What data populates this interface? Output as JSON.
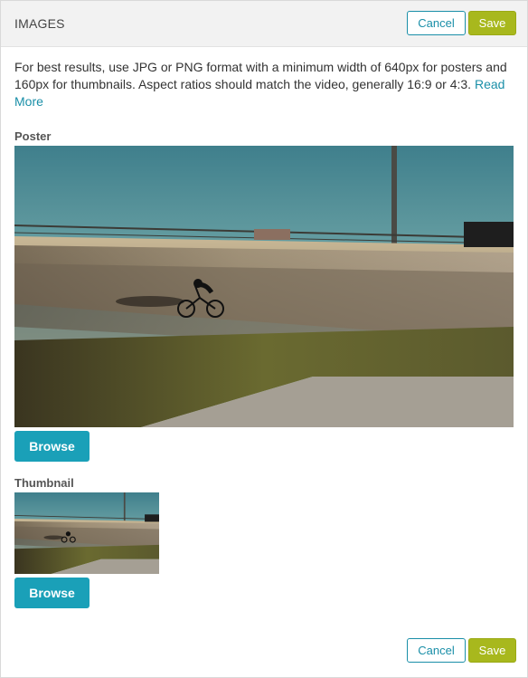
{
  "header": {
    "title": "IMAGES",
    "cancel_label": "Cancel",
    "save_label": "Save"
  },
  "intro": {
    "text": "For best results, use JPG or PNG format with a minimum width of 640px for posters and 160px for thumbnails. Aspect ratios should match the video, generally 16:9 or 4:3.",
    "link": "Read More"
  },
  "poster": {
    "label": "Poster",
    "browse_label": "Browse"
  },
  "thumbnail": {
    "label": "Thumbnail",
    "browse_label": "Browse"
  },
  "footer": {
    "cancel_label": "Cancel",
    "save_label": "Save"
  },
  "colors": {
    "accent": "#1aa0b8",
    "save": "#a8b81d"
  }
}
